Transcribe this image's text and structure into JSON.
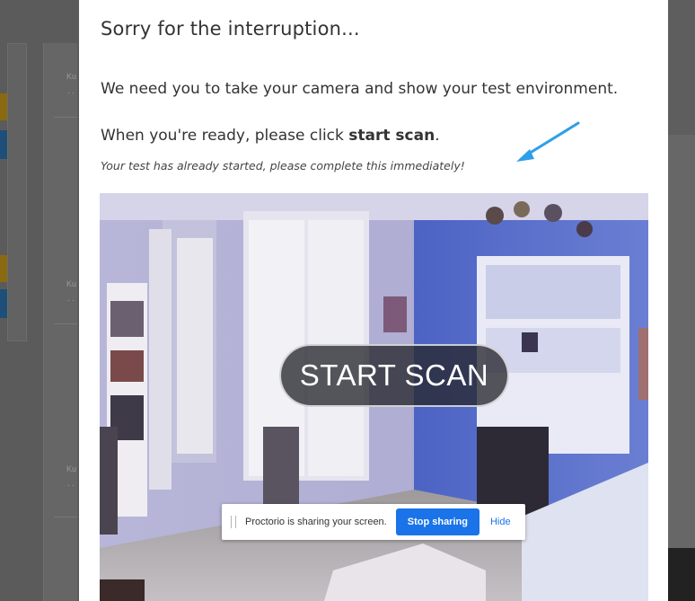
{
  "background": {
    "card_labels": [
      "Ku",
      "Ku",
      "Ku"
    ],
    "card_sublabels": [
      "٠٠",
      "٠٠",
      "٠٠"
    ]
  },
  "modal": {
    "title": "Sorry for the interruption...",
    "instruction": "We need you to take your camera and show your test environment.",
    "ready_prefix": "When you're ready, please click ",
    "ready_action": "start scan",
    "ready_suffix": ".",
    "note": "Your test has already started, please complete this immediately!",
    "arrow_color": "#2e9fe8"
  },
  "camera": {
    "start_scan_label": "START SCAN"
  },
  "share_bar": {
    "message": "Proctorio is sharing your screen.",
    "stop_label": "Stop sharing",
    "hide_label": "Hide",
    "accent": "#1a73e8"
  }
}
